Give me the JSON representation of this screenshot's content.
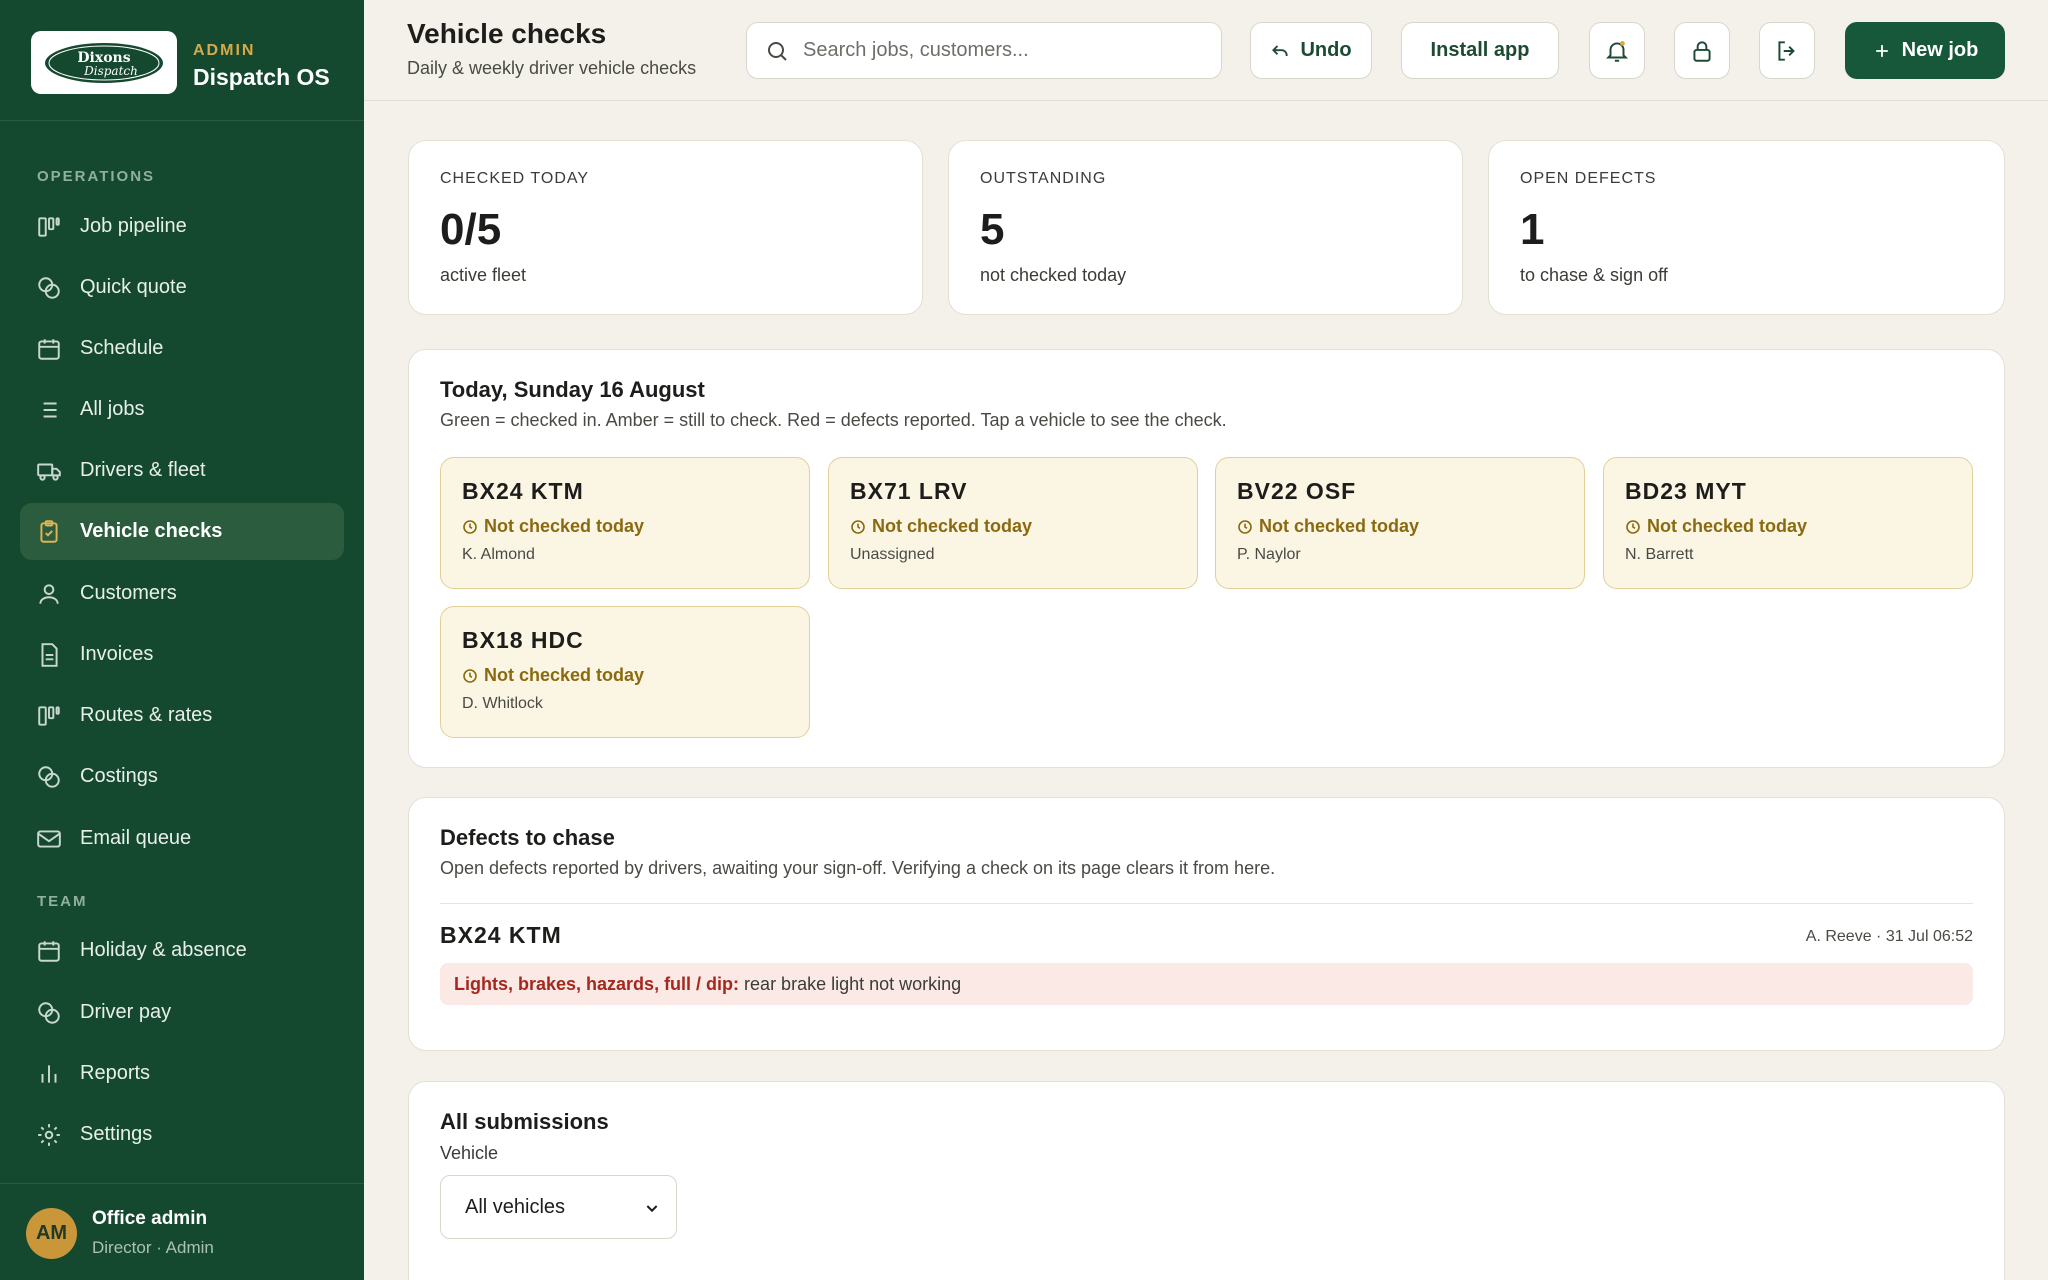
{
  "brand": {
    "logo_text": "Dixons Dispatch",
    "role": "ADMIN",
    "name": "Dispatch OS"
  },
  "sidebar": {
    "sections": [
      {
        "title": "OPERATIONS"
      },
      {
        "title": "TEAM"
      }
    ],
    "items": [
      {
        "label": "Job pipeline",
        "icon": "pipeline-icon"
      },
      {
        "label": "Quick quote",
        "icon": "coins-icon"
      },
      {
        "label": "Schedule",
        "icon": "calendar-icon"
      },
      {
        "label": "All jobs",
        "icon": "list-icon"
      },
      {
        "label": "Drivers & fleet",
        "icon": "truck-icon"
      },
      {
        "label": "Vehicle checks",
        "icon": "clipboard-check-icon",
        "active": true
      },
      {
        "label": "Customers",
        "icon": "user-icon"
      },
      {
        "label": "Invoices",
        "icon": "document-icon"
      },
      {
        "label": "Routes & rates",
        "icon": "pipeline-icon"
      },
      {
        "label": "Costings",
        "icon": "coins-icon"
      },
      {
        "label": "Email queue",
        "icon": "mail-icon"
      },
      {
        "label": "Holiday & absence",
        "icon": "calendar-icon"
      },
      {
        "label": "Driver pay",
        "icon": "coins-icon"
      },
      {
        "label": "Reports",
        "icon": "bar-chart-icon"
      },
      {
        "label": "Settings",
        "icon": "gear-icon"
      }
    ]
  },
  "user": {
    "initials": "AM",
    "name": "Office admin",
    "role": "Director · Admin"
  },
  "header": {
    "title": "Vehicle checks",
    "subtitle": "Daily & weekly driver vehicle checks",
    "search_placeholder": "Search jobs, customers...",
    "undo_label": "Undo",
    "install_label": "Install app",
    "new_job_label": "New job"
  },
  "stats": [
    {
      "label": "CHECKED TODAY",
      "value": "0/5",
      "sub": "active fleet"
    },
    {
      "label": "OUTSTANDING",
      "value": "5",
      "sub": "not checked today"
    },
    {
      "label": "OPEN DEFECTS",
      "value": "1",
      "sub": "to chase & sign off"
    }
  ],
  "today": {
    "title": "Today, Sunday 16 August",
    "description": "Green = checked in. Amber = still to check. Red = defects reported. Tap a vehicle to see the check.",
    "vehicles": [
      {
        "reg": "BX24 KTM",
        "status": "Not checked today",
        "driver": "K. Almond"
      },
      {
        "reg": "BX71 LRV",
        "status": "Not checked today",
        "driver": "Unassigned"
      },
      {
        "reg": "BV22 OSF",
        "status": "Not checked today",
        "driver": "P. Naylor"
      },
      {
        "reg": "BD23 MYT",
        "status": "Not checked today",
        "driver": "N. Barrett"
      },
      {
        "reg": "BX18 HDC",
        "status": "Not checked today",
        "driver": "D. Whitlock"
      }
    ]
  },
  "defects": {
    "title": "Defects to chase",
    "description": "Open defects reported by drivers, awaiting your sign-off. Verifying a check on its page clears it from here.",
    "items": [
      {
        "reg": "BX24 KTM",
        "meta": "A. Reeve · 31 Jul 06:52",
        "category": "Lights, brakes, hazards, full / dip:",
        "detail": " rear brake light not working"
      }
    ]
  },
  "submissions": {
    "title": "All submissions",
    "filter_label": "Vehicle",
    "filter_value": "All vehicles"
  },
  "colors": {
    "sidebar": "#15492f",
    "accent_gold": "#d6a94a",
    "primary_button": "#17583a",
    "amber_card": "#fbf5e4",
    "amber_text": "#8a6a10",
    "defect_bg": "#fbe9e6",
    "defect_text": "#a4281d"
  }
}
